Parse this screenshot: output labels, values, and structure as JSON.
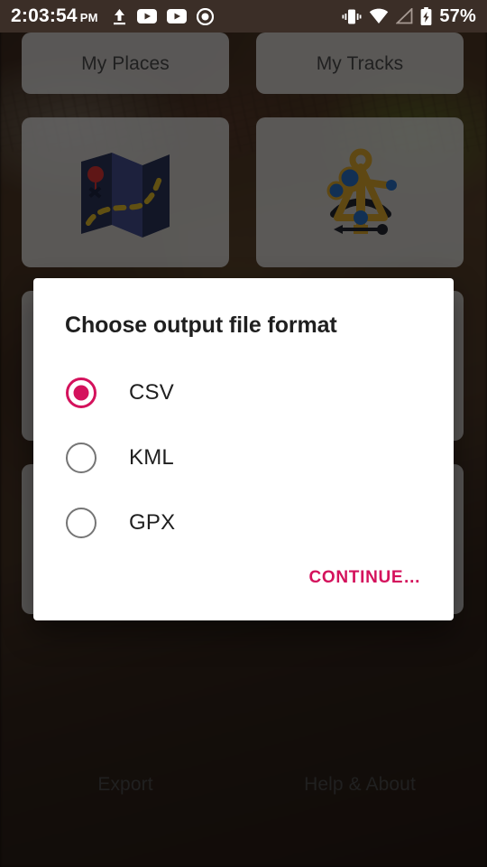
{
  "status_bar": {
    "time": "2:03:54",
    "am_pm": "PM",
    "left_icons": [
      "upload-icon",
      "youtube-play-icon",
      "youtube-play-icon",
      "record-dot-icon"
    ],
    "right_icons": [
      "vibrate-icon",
      "wifi-icon",
      "signal-icon",
      "battery-charging-icon"
    ],
    "battery_percent": "57%",
    "background_color": "#3b2e27",
    "foreground_color": "#ffffff"
  },
  "home": {
    "tiles": [
      {
        "label": "My Places",
        "icon": "",
        "row": "top"
      },
      {
        "label": "My Tracks",
        "icon": "",
        "row": "top"
      },
      {
        "label": "",
        "icon": "folded-map-icon",
        "row": "mid"
      },
      {
        "label": "",
        "icon": "sextant-icon",
        "row": "mid"
      },
      {
        "label": "",
        "icon": "hidden-icon",
        "row": "hidden"
      },
      {
        "label": "",
        "icon": "hidden-icon",
        "row": "hidden"
      },
      {
        "label": "Export",
        "icon": "share-export-icon",
        "row": "bottom"
      },
      {
        "label": "Help & About",
        "icon": "help-person-icon",
        "row": "bottom"
      }
    ]
  },
  "dialog": {
    "title": "Choose output file format",
    "options": [
      {
        "label": "CSV",
        "selected": true
      },
      {
        "label": "KML",
        "selected": false
      },
      {
        "label": "GPX",
        "selected": false
      }
    ],
    "continue_label": "CONTINUE…",
    "accent_color": "#d4125c",
    "background_color": "#ffffff",
    "title_color": "#1f1f1f"
  }
}
